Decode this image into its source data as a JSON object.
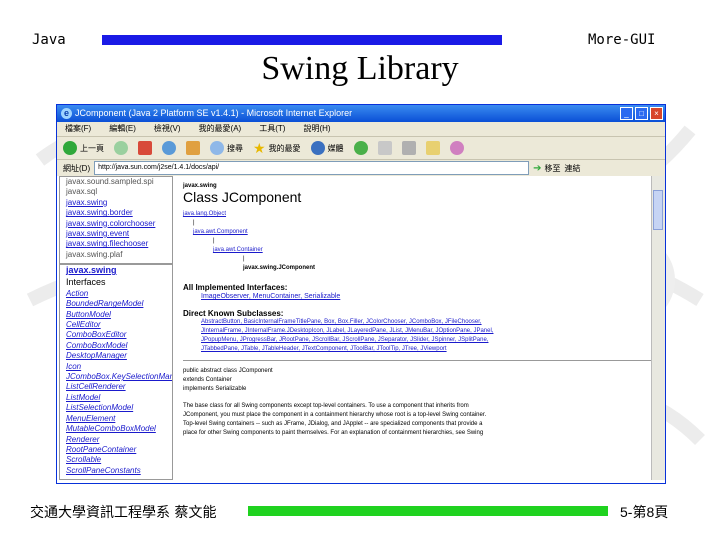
{
  "slide": {
    "header_left": "Java",
    "header_right": "More-GUI",
    "title": "Swing Library",
    "footer_left": "交通大學資訊工程學系 蔡文能",
    "footer_right": "5-第8頁",
    "header_bar_color": "#1a1ae6",
    "footer_bar_color": "#1fd21f"
  },
  "browser": {
    "window_title": "JComponent (Java 2 Platform SE v1.4.1) - Microsoft Internet Explorer",
    "menu": [
      "檔案(F)",
      "編輯(E)",
      "檢視(V)",
      "我的最愛(A)",
      "工具(T)",
      "說明(H)"
    ],
    "toolbar": [
      {
        "label": "上一頁",
        "icon": "back-icon"
      },
      {
        "label": "",
        "icon": "forward-icon"
      },
      {
        "label": "",
        "icon": "stop-icon"
      },
      {
        "label": "",
        "icon": "refresh-icon"
      },
      {
        "label": "",
        "icon": "home-icon"
      },
      {
        "label": "搜尋",
        "icon": "search-icon"
      },
      {
        "label": "我的最愛",
        "icon": "favorites-icon"
      },
      {
        "label": "媒體",
        "icon": "media-icon"
      },
      {
        "label": "",
        "icon": "history-icon"
      }
    ],
    "address_label": "網址(D)",
    "address_value": "http://java.sun.com/j2se/1.4.1/docs/api/",
    "go_label": "移至",
    "links_label": "連結"
  },
  "packages_frame": {
    "items": [
      "javax.sound.sampled.spi",
      "javax.sql",
      "javax.swing",
      "javax.swing.border",
      "javax.swing.colorchooser",
      "javax.swing.event",
      "javax.swing.filechooser",
      "javax.swing.plaf"
    ]
  },
  "classes_frame": {
    "package": "javax.swing",
    "heading": "Interfaces",
    "items": [
      "Action",
      "BoundedRangeModel",
      "ButtonModel",
      "CellEditor",
      "ComboBoxEditor",
      "ComboBoxModel",
      "DesktopManager",
      "Icon",
      "JComboBox.KeySelectionManager",
      "ListCellRenderer",
      "ListModel",
      "ListSelectionModel",
      "MenuElement",
      "MutableComboBoxModel",
      "Renderer",
      "RootPaneContainer",
      "Scrollable",
      "ScrollPaneConstants"
    ]
  },
  "main_frame": {
    "package": "javax.swing",
    "class_title": "Class JComponent",
    "hierarchy": [
      "java.lang.Object",
      "java.awt.Component",
      "java.awt.Container",
      "javax.swing.JComponent"
    ],
    "impl_heading": "All Implemented Interfaces:",
    "impl_items": "ImageObserver, MenuContainer, Serializable",
    "sub_heading": "Direct Known Subclasses:",
    "sub_lines": [
      "AbstractButton, BasicInternalFrameTitlePane, Box, Box.Filler, JColorChooser, JComboBox, JFileChooser,",
      "JInternalFrame, JInternalFrame.JDesktopIcon, JLabel, JLayeredPane, JList, JMenuBar, JOptionPane, JPanel,",
      "JPopupMenu, JProgressBar, JRootPane, JScrollBar, JScrollPane, JSeparator, JSlider, JSpinner, JSplitPane,",
      "JTabbedPane, JTable, JTableHeader, JTextComponent, JToolBar, JToolTip, JTree, JViewport"
    ],
    "decl_lines": [
      "public abstract class JComponent",
      "extends Container",
      "implements Serializable"
    ],
    "desc_lines": [
      "The base class for all Swing components except top-level containers. To use a component that inherits from",
      "JComponent, you must place the component in a containment hierarchy whose root is a top-level Swing container.",
      "Top-level Swing containers -- such as JFrame, JDialog, and JApplet -- are specialized components that provide a",
      "place for other Swing components to paint themselves. For an explanation of containment hierarchies, see Swing"
    ]
  }
}
